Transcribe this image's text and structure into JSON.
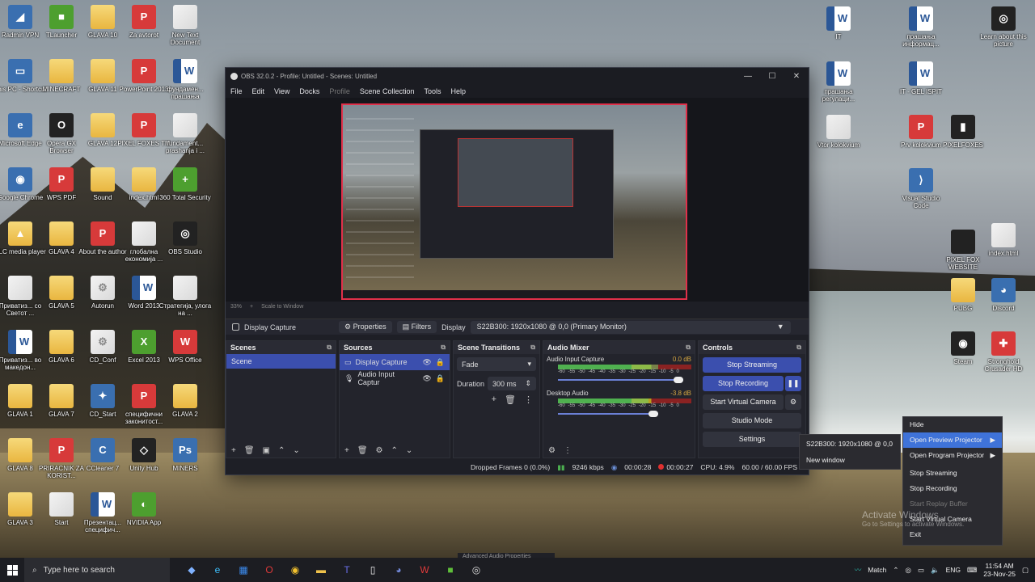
{
  "desktop": {
    "icons": [
      {
        "label": "Radmin VPN",
        "kind": "app",
        "glyph": "◢"
      },
      {
        "label": "TLauncher",
        "kind": "green",
        "glyph": "■"
      },
      {
        "label": "GLAVA 10",
        "kind": "folder",
        "glyph": ""
      },
      {
        "label": "Za avtorot",
        "kind": "pdf",
        "glyph": "P"
      },
      {
        "label": "New Text Document",
        "kind": "doc",
        "glyph": ""
      },
      {
        "label": "This PC - Shortcut",
        "kind": "app",
        "glyph": "▭"
      },
      {
        "label": "MINECRAFT",
        "kind": "folder",
        "glyph": ""
      },
      {
        "label": "GLAVA 11",
        "kind": "folder",
        "glyph": ""
      },
      {
        "label": "PowerPoint 2013",
        "kind": "pdf",
        "glyph": "P"
      },
      {
        "label": "фундамен... прашања",
        "kind": "word",
        "glyph": "W"
      },
      {
        "label": "Microsoft Edge",
        "kind": "app",
        "glyph": "e"
      },
      {
        "label": "Opera GX Browser",
        "kind": "dark",
        "glyph": "O"
      },
      {
        "label": "GLAVA 12",
        "kind": "folder",
        "glyph": ""
      },
      {
        "label": "PIXEL FOXES TM",
        "kind": "pdf",
        "glyph": "P"
      },
      {
        "label": "fundament... prashanja i ...",
        "kind": "doc",
        "glyph": ""
      },
      {
        "label": "Google Chrome",
        "kind": "app",
        "glyph": "◉"
      },
      {
        "label": "WPS PDF",
        "kind": "pdf",
        "glyph": "P"
      },
      {
        "label": "Sound",
        "kind": "folder",
        "glyph": ""
      },
      {
        "label": "index.html",
        "kind": "folder",
        "glyph": ""
      },
      {
        "label": "360 Total Security",
        "kind": "green",
        "glyph": "+"
      },
      {
        "label": "VLC media player",
        "kind": "folder",
        "glyph": "▲"
      },
      {
        "label": "GLAVA 4",
        "kind": "folder",
        "glyph": ""
      },
      {
        "label": "About the author",
        "kind": "pdf",
        "glyph": "P"
      },
      {
        "label": "глобална економија ...",
        "kind": "doc",
        "glyph": ""
      },
      {
        "label": "OBS Studio",
        "kind": "dark",
        "glyph": "◎"
      },
      {
        "label": "Приватиз... со Светот ...",
        "kind": "doc",
        "glyph": ""
      },
      {
        "label": "GLAVA 5",
        "kind": "folder",
        "glyph": ""
      },
      {
        "label": "Autorun",
        "kind": "doc",
        "glyph": "⚙"
      },
      {
        "label": "Word 2013",
        "kind": "word",
        "glyph": "W"
      },
      {
        "label": "Стратегија, улога на ...",
        "kind": "doc",
        "glyph": ""
      },
      {
        "label": "Приватиз... во македон...",
        "kind": "word",
        "glyph": "W"
      },
      {
        "label": "GLAVA 6",
        "kind": "folder",
        "glyph": ""
      },
      {
        "label": "CD_Conf",
        "kind": "doc",
        "glyph": "⚙"
      },
      {
        "label": "Excel 2013",
        "kind": "green",
        "glyph": "X"
      },
      {
        "label": "WPS Office",
        "kind": "pdf",
        "glyph": "W"
      },
      {
        "label": "GLAVA 1",
        "kind": "folder",
        "glyph": ""
      },
      {
        "label": "GLAVA 7",
        "kind": "folder",
        "glyph": ""
      },
      {
        "label": "CD_Start",
        "kind": "app",
        "glyph": "✦"
      },
      {
        "label": "специфични законитост...",
        "kind": "pdf",
        "glyph": "P"
      },
      {
        "label": "GLAVA 2",
        "kind": "folder",
        "glyph": ""
      },
      {
        "label": "GLAVA 8",
        "kind": "folder",
        "glyph": ""
      },
      {
        "label": "PRIRACNIK ZA KORIST...",
        "kind": "pdf",
        "glyph": "P"
      },
      {
        "label": "CCleaner 7",
        "kind": "app",
        "glyph": "C"
      },
      {
        "label": "Unity Hub",
        "kind": "dark",
        "glyph": "◇"
      },
      {
        "label": "MINERS",
        "kind": "app",
        "glyph": "Ps"
      },
      {
        "label": "GLAVA 3",
        "kind": "folder",
        "glyph": ""
      },
      {
        "label": "Start",
        "kind": "doc",
        "glyph": ""
      },
      {
        "label": "Презентац... специфич...",
        "kind": "word",
        "glyph": "W"
      },
      {
        "label": "NVIDIA App",
        "kind": "green",
        "glyph": "◐"
      }
    ],
    "right_icons": [
      {
        "label": "IT",
        "kind": "word",
        "glyph": "W"
      },
      {
        "label": "прашања информац...",
        "kind": "word",
        "glyph": "W"
      },
      {
        "label": "Learn about this picture",
        "kind": "dark",
        "glyph": "◎"
      },
      {
        "label": "прашања регулаци...",
        "kind": "word",
        "glyph": "W"
      },
      {
        "label": "IT - GEL ISPIT",
        "kind": "word",
        "glyph": "W"
      },
      {
        "label": "Vtor kolokvium",
        "kind": "doc",
        "glyph": ""
      },
      {
        "label": "Prv kolokvium",
        "kind": "pdf",
        "glyph": "P"
      },
      {
        "label": "PIXELFOXES",
        "kind": "dark",
        "glyph": "▮"
      },
      {
        "label": "Visual Studio Code",
        "kind": "app",
        "glyph": "⟩"
      },
      {
        "label": "PIXEL FOX WEBSITE",
        "kind": "dark",
        "glyph": ""
      },
      {
        "label": "index.html",
        "kind": "doc",
        "glyph": ""
      },
      {
        "label": "PUBG",
        "kind": "folder",
        "glyph": ""
      },
      {
        "label": "Discord",
        "kind": "app",
        "glyph": "◕"
      },
      {
        "label": "Steam",
        "kind": "dark",
        "glyph": "◉"
      },
      {
        "label": "Stronghold Crusader HD",
        "kind": "pdf",
        "glyph": "✚"
      }
    ]
  },
  "obs": {
    "title": "OBS 32.0.2 - Profile: Untitled - Scenes: Untitled",
    "window_buttons": [
      "—",
      "☐",
      "✕"
    ],
    "menu": [
      "File",
      "Edit",
      "View",
      "Docks",
      "Profile",
      "Scene Collection",
      "Tools",
      "Help"
    ],
    "zoom": {
      "percent": "33%",
      "plus": "+",
      "scale_label": "Scale to Window"
    },
    "context": {
      "source": "Display Capture",
      "properties": "Properties",
      "filters": "Filters",
      "display_label": "Display",
      "display_value": "S22B300: 1920x1080 @ 0,0 (Primary Monitor)"
    },
    "scenes": {
      "title": "Scenes",
      "items": [
        "Scene"
      ]
    },
    "sources": {
      "title": "Sources",
      "items": [
        "Display Capture",
        "Audio Input Captur"
      ]
    },
    "transitions": {
      "title": "Scene Transitions",
      "value": "Fade",
      "duration_label": "Duration",
      "duration_value": "300 ms"
    },
    "mixer": {
      "title": "Audio Mixer",
      "channels": [
        {
          "name": "Audio Input Capture",
          "db": "0.0 dB",
          "level": 0.75,
          "volume": 1.0
        },
        {
          "name": "Desktop Audio",
          "db": "-3.8 dB",
          "level": 0.68,
          "volume": 0.8
        }
      ],
      "ticks": [
        "-60",
        "-55",
        "-50",
        "-45",
        "-40",
        "-35",
        "-30",
        "-25",
        "-20",
        "-15",
        "-10",
        "-5",
        "0"
      ]
    },
    "controls": {
      "title": "Controls",
      "stop_streaming": "Stop Streaming",
      "stop_recording": "Stop Recording",
      "pause": "❚❚",
      "virtual_camera": "Start Virtual Camera",
      "studio_mode": "Studio Mode",
      "settings": "Settings"
    },
    "status": {
      "dropped": "Dropped Frames 0 (0.0%)",
      "bitrate": "9246 kbps",
      "stream_time": "00:00:28",
      "rec_time": "00:00:27",
      "cpu": "CPU: 4.9%",
      "fps": "60.00 / 60.00 FPS"
    }
  },
  "submenu": {
    "items": [
      "S22B300: 1920x1080 @ 0,0",
      "New window"
    ]
  },
  "tray_menu": {
    "items": [
      {
        "label": "Hide",
        "state": "normal",
        "arrow": ""
      },
      {
        "label": "Open Preview Projector",
        "state": "highlight",
        "arrow": "▶"
      },
      {
        "label": "Open Program Projector",
        "state": "normal",
        "arrow": "▶"
      },
      {
        "label": "Stop Streaming",
        "state": "normal",
        "arrow": ""
      },
      {
        "label": "Stop Recording",
        "state": "normal",
        "arrow": ""
      },
      {
        "label": "Start Replay Buffer",
        "state": "disabled",
        "arrow": ""
      },
      {
        "label": "Start Virtual Camera",
        "state": "normal",
        "arrow": ""
      },
      {
        "label": "Exit",
        "state": "normal",
        "arrow": ""
      }
    ]
  },
  "watermark": {
    "title": "Activate Windows",
    "subtitle": "Go to Settings to activate Windows."
  },
  "ghost_window": "Advanced Audio Properties",
  "taskbar": {
    "search_placeholder": "Type here to search",
    "weather": "Match",
    "lang": "ENG",
    "time": "11:54 AM",
    "date": "23-Nov-25"
  }
}
